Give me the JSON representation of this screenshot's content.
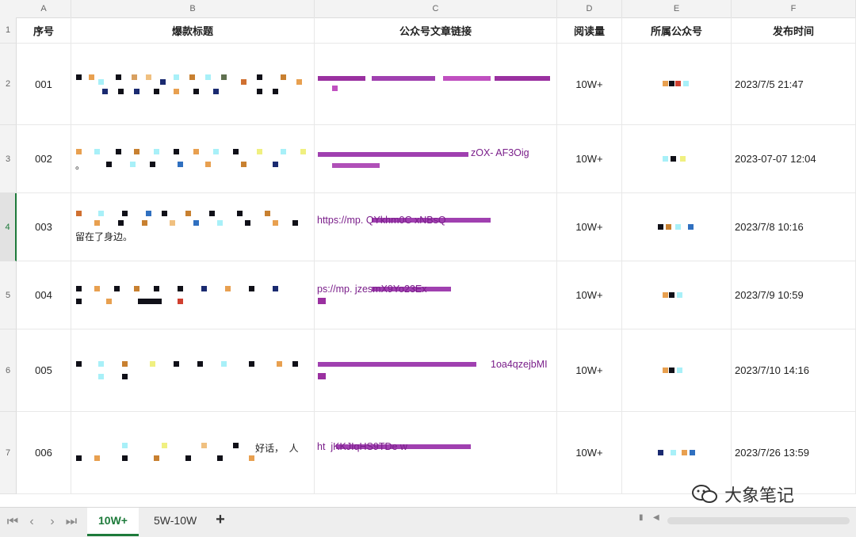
{
  "columns": [
    {
      "letter": "A",
      "header": "序号"
    },
    {
      "letter": "B",
      "header": "爆款标题"
    },
    {
      "letter": "C",
      "header": "公众号文章链接"
    },
    {
      "letter": "D",
      "header": "阅读量"
    },
    {
      "letter": "E",
      "header": "所属公众号"
    },
    {
      "letter": "F",
      "header": "发布时间"
    }
  ],
  "row_numbers": [
    "1",
    "2",
    "3",
    "4",
    "5",
    "6",
    "7"
  ],
  "rows": [
    {
      "no": "001",
      "title_visible": "",
      "link_visible": "",
      "reads": "10W+",
      "time": "2023/7/5 21:47"
    },
    {
      "no": "002",
      "title_visible": "。",
      "link_visible": "zOX-  AF3Oig",
      "reads": "10W+",
      "time": "2023-07-07 12:04"
    },
    {
      "no": "003",
      "title_visible": "留在了身边。",
      "link_visible": "https://mp.  QYkhm0C xNBsQ",
      "reads": "10W+",
      "time": "2023/7/8 10:16"
    },
    {
      "no": "004",
      "title_visible": "",
      "link_visible": "ps://mp.  jzesmX9Yo23Ex",
      "reads": "10W+",
      "time": "2023/7/9 10:59"
    },
    {
      "no": "005",
      "title_visible": "",
      "link_visible": "1oa4qzejbMI",
      "reads": "10W+",
      "time": "2023/7/10 14:16"
    },
    {
      "no": "006",
      "title_visible": "好话，  人",
      "link_visible": "ht  jKKJIqHS9TDe w",
      "reads": "10W+",
      "time": "2023/7/26 13:59"
    }
  ],
  "sheet_tabs": [
    {
      "label": "10W+",
      "active": true
    },
    {
      "label": "5W-10W",
      "active": false
    }
  ],
  "add_tab_label": "+",
  "watermark": "大象笔记",
  "colors": {
    "accent": "#1d7a3a",
    "link": "#7a1e8a"
  }
}
